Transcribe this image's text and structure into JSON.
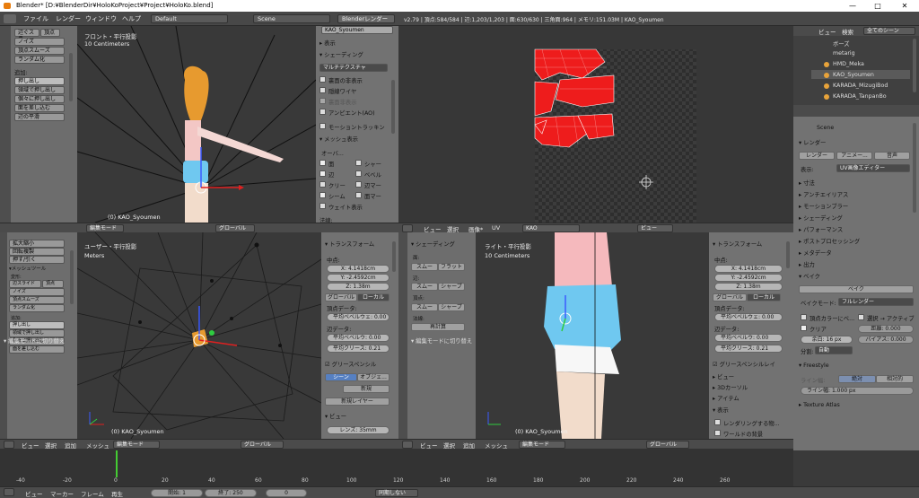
{
  "window": {
    "title": "Blender* [D:¥BlenderDir¥HoloKoProject¥Project¥HoloKo.blend]",
    "min": "—",
    "max": "□",
    "close": "✕"
  },
  "menu": {
    "file": "ファイル",
    "render": "レンダー",
    "window": "ウィンドウ",
    "help": "ヘルプ",
    "layout": "Default",
    "scene": "Scene",
    "engine": "Blenderレンダー",
    "stats": "v2.79 | 頂点:584/584 | 辺:1,203/1,203 | 面:630/630 | 三角面:964 | メモリ:151.03M | KAO_Syoumen"
  },
  "toolshelf_tl": {
    "items": [
      "辺ぐスラ",
      "頂点",
      "ノイズ",
      "頂点スムーズ",
      "ランダム化"
    ],
    "add_label": "追加:",
    "extrude": "押し出し",
    "extrude_indiv": "領域で押し出し",
    "extrude_each": "個々に押し出し",
    "inset": "面を差し込む",
    "more": "辺の平滑"
  },
  "viewport_tl": {
    "title": "フロント・平行投影",
    "units": "10 Centimeters",
    "object": "(0) KAO_Syoumen"
  },
  "props_tl": {
    "mesh": "KAO_Syoumen",
    "display": "▸ 表示",
    "shading": "▾ シェーディング",
    "multitex": "マルチテクスチャ",
    "tex_solid": "裏面の非表示",
    "hidden_wire": "隠線ワイヤ",
    "backface": "裏面非表示",
    "ao": "アンビエント(AO)",
    "motion": "モーショントラッキン",
    "mesh_display": "▾ メッシュ表示",
    "overlay": "オーバ...",
    "faces": "面",
    "sharp": "シャー",
    "edges": "辺",
    "bevel": "ベベル",
    "crease": "クリー",
    "edge_m": "辺マー",
    "seams": "シーム",
    "face_m": "面マー",
    "weight": "ウェイト表示",
    "normals": "法線:"
  },
  "uv_header": {
    "view": "ビュー",
    "select": "選択",
    "image": "画像*",
    "uv": "UV",
    "image_name": "KAO",
    "view2": "ビュー"
  },
  "toolshelf_bl": {
    "items": [
      "拡大縮小",
      "回転複製",
      "押す/引く"
    ],
    "mesh_tools": "▾メッシュツール",
    "deform": "変形:",
    "slide": "辺スライド",
    "vert": "頂点",
    "noise": "ノイズ",
    "smooth": "頂点スムーズ",
    "random": "ランダム化",
    "add": "追加:",
    "extrude": "押し出し",
    "extrude_r": "領域で押し出し",
    "extrude_i": "個々に押し出し",
    "inset": "面を差し込む",
    "toggle": "▾ 編集モードに切り替え"
  },
  "viewport_bl": {
    "title": "ユーザー・平行投影",
    "units": "Meters",
    "object": "(0) KAO_Syoumen"
  },
  "nprops_bl": {
    "transform": "▾ トランスフォーム",
    "median": "中点:",
    "x": "X:",
    "xv": "4.1418cm",
    "y": "Y:",
    "yv": "-2.4592cm",
    "z": "Z:",
    "zv": "1.38m",
    "global": "グローバル",
    "local": "ローカル",
    "vdata": "頂点データ:",
    "bweight": "平均ベベルウェ:",
    "bw_v": "0.00",
    "edata": "辺データ:",
    "ebweight": "平均ベベルウ:",
    "eb_v": "0.00",
    "crease": "平均クリース:",
    "cr_v": "0.21",
    "grease": "☑ グリースペンシル",
    "scene": "シーン",
    "object": "オブジェ...",
    "new": "新規",
    "new_layer": "新規レイヤー",
    "view": "▾ ビュー",
    "lens": "レンズ:",
    "lens_v": "35mm"
  },
  "toolshelf_br": {
    "shading": "▾ シェーディング",
    "face": "面:",
    "smooth": "スムー",
    "flat": "フラット",
    "edge": "辺:",
    "smooth2": "スムー",
    "sharp": "シャープ",
    "vert": "頂点:",
    "smooth3": "スムー",
    "sharp2": "シャープ",
    "normals": "法線:",
    "recalc": "再計算",
    "toggle": "▾ 編集モードに切り替え"
  },
  "viewport_br": {
    "title": "ライト・平行投影",
    "units": "10 Centimeters",
    "object": "(0) KAO_Syoumen"
  },
  "nprops_br": {
    "transform": "▾ トランスフォーム",
    "median": "中点:",
    "xv": "4.1418cm",
    "yv": "-2.4592cm",
    "zv": "1.38m",
    "global": "グローバル",
    "local": "ローカル",
    "vdata": "頂点データ:",
    "bweight": "平均ベベルウェ:",
    "bw_v": "0.00",
    "edata": "辺データ:",
    "ebweight": "平均ベベルウ:",
    "eb_v": "0.00",
    "crease": "平均クリース:",
    "cr_v": "0.21",
    "grease": "☑ グリースペンシルレイ",
    "view": "▸ ビュー",
    "cursor": "▸ 3Dカーソル",
    "item": "▸ アイテム",
    "display": "▾ 表示",
    "render_only": "レンダリングする物...",
    "world_bg": "ワールドの背景"
  },
  "header3d": {
    "view": "ビュー",
    "select": "選択",
    "add": "追加",
    "mesh": "メッシュ",
    "mode": "編集モード",
    "global": "グローバル"
  },
  "outliner": {
    "view": "ビュー",
    "search": "検索",
    "all_scenes": "全てのシーン",
    "items": [
      "ボーズ",
      "metarig",
      "HMD_Meka",
      "KAO_Syoumen",
      "KARADA_MizugiBod",
      "KARADA_TanpanBo"
    ]
  },
  "properties": {
    "scene": "Scene",
    "render": "▾ レンダー",
    "btn_render": "レンダー",
    "btn_anim": "アニメー...",
    "btn_audio": "音声",
    "display": "表示:",
    "display_v": "UV画像エディター",
    "dims": "▸ 寸法",
    "aa": "▸ アンチエイリアス",
    "mblur": "▸ モーションブラー",
    "shading": "▸ シェーディング",
    "perf": "▸ パフォーマンス",
    "post": "▸ ポストプロセッシング",
    "meta": "▸ メタデータ",
    "output": "▸ 出力",
    "bake": "▾ ベイク",
    "bake_btn": "ベイク",
    "bake_mode": "ベイクモード:",
    "bake_mode_v": "フルレンダー",
    "vcol": "頂点カラーにベ...",
    "sel_active": "選択 → アクティブ",
    "clear": "クリア",
    "margin": "余白:",
    "margin_v": "16 px",
    "dist": "距離:",
    "dist_v": "0.000",
    "bias": "バイアス:",
    "bias_v": "0.000",
    "split": "分割:",
    "split_v": "自動",
    "freestyle": "▾ Freestyle",
    "line_width": "ライン幅:",
    "abs": "絶対",
    "rel": "相対的",
    "line_thick": "ライン幅:",
    "lt_v": "1.000 px",
    "tex_atlas": "▸ Texture Atlas"
  },
  "timeline": {
    "view": "ビュー",
    "marker": "マーカー",
    "frame": "フレーム",
    "play": "再生",
    "start": "開始:",
    "start_v": "1",
    "end": "終了:",
    "end_v": "250",
    "cur": "0",
    "sync": "同期しない",
    "ticks": [
      "-40",
      "-20",
      "0",
      "20",
      "40",
      "60",
      "80",
      "100",
      "120",
      "140",
      "160",
      "180",
      "200",
      "220",
      "240",
      "260"
    ]
  }
}
